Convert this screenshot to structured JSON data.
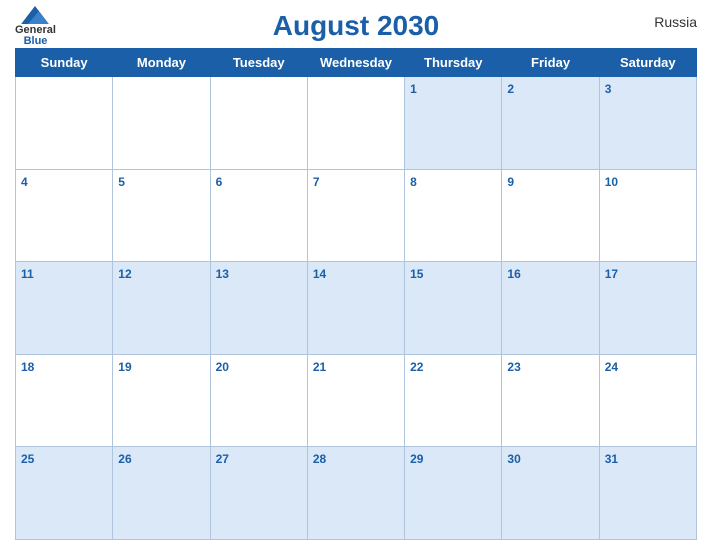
{
  "header": {
    "title": "August 2030",
    "country": "Russia",
    "logo": {
      "general": "General",
      "blue": "Blue"
    }
  },
  "weekdays": [
    "Sunday",
    "Monday",
    "Tuesday",
    "Wednesday",
    "Thursday",
    "Friday",
    "Saturday"
  ],
  "weeks": [
    [
      "",
      "",
      "",
      "",
      "1",
      "2",
      "3"
    ],
    [
      "4",
      "5",
      "6",
      "7",
      "8",
      "9",
      "10"
    ],
    [
      "11",
      "12",
      "13",
      "14",
      "15",
      "16",
      "17"
    ],
    [
      "18",
      "19",
      "20",
      "21",
      "22",
      "23",
      "24"
    ],
    [
      "25",
      "26",
      "27",
      "28",
      "29",
      "30",
      "31"
    ]
  ],
  "colors": {
    "header_bg": "#1a5fa8",
    "row_odd": "#dbe8f8",
    "row_even": "#ffffff",
    "day_num": "#1a5fa8",
    "border": "#b0c4de"
  }
}
